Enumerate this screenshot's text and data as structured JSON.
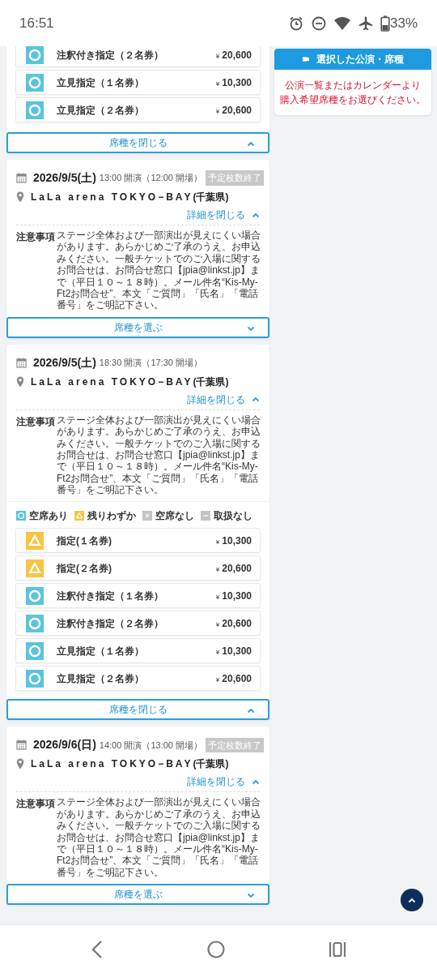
{
  "status_bar": {
    "time": "16:51",
    "battery": "33%"
  },
  "sidebar": {
    "title": "選択した公演・席種",
    "message_lines": [
      "公演一覧またはカレンダーより",
      "購入希望席種をお選びください。"
    ]
  },
  "performances": [
    {
      "kind": "partial",
      "seats_expanded": true,
      "seat_toggle": "席種を閉じる",
      "seats": [
        {
          "kind": "available",
          "name": "注釈付き指定（２名券）",
          "currency": "¥",
          "price": "20,600"
        },
        {
          "kind": "available",
          "name": "立見指定（１名券）",
          "currency": "¥",
          "price": "10,300"
        },
        {
          "kind": "available",
          "name": "立見指定（２名券）",
          "currency": "¥",
          "price": "20,600"
        }
      ]
    },
    {
      "kind": "full",
      "date": "2026/9/5(土)",
      "time": "13:00 開演（12:00 開場）",
      "badge": "予定枚数終了",
      "venue": "LaLa arena TOKYO−BAY",
      "prefecture": "(千葉県)",
      "details_toggle": "詳細を閉じる",
      "details_expanded": true,
      "notes_label": "注意事項",
      "notes": "ステージ全体および一部演出が見えにくい場合があります。あらかじめご了承のうえ、お申込みください。一般チケットでのご入場に関するお問合せは、お問合せ窓口【jpia@linkst.jp】まで（平日１０～１８時）。メール件名“Kis-My-Ft2お問合せ”、本文「ご質問」「氏名」「電話番号」をご明記下さい。",
      "seats_expanded": false,
      "seat_toggle": "席種を選ぶ"
    },
    {
      "kind": "full",
      "date": "2026/9/5(土)",
      "time": "18:30 開演（17:30 開場）",
      "venue": "LaLa arena TOKYO−BAY",
      "prefecture": "(千葉県)",
      "details_toggle": "詳細を閉じる",
      "details_expanded": true,
      "notes_label": "注意事項",
      "notes": "ステージ全体および一部演出が見えにくい場合があります。あらかじめご了承のうえ、お申込みください。一般チケットでのご入場に関するお問合せは、お問合せ窓口【jpia@linkst.jp】まで（平日１０～１８時）。メール件名“Kis-My-Ft2お問合せ”、本文「ご質問」「氏名」「電話番号」をご明記下さい。",
      "legend": [
        {
          "kind": "available",
          "label": "空席あり"
        },
        {
          "kind": "few",
          "label": "残りわずか"
        },
        {
          "kind": "none",
          "label": "空席なし"
        },
        {
          "kind": "na",
          "label": "取扱なし"
        }
      ],
      "seats_expanded": true,
      "seat_toggle": "席種を閉じる",
      "seats": [
        {
          "kind": "few",
          "name": "指定(１名券)",
          "currency": "¥",
          "price": "10,300"
        },
        {
          "kind": "few",
          "name": "指定(２名券)",
          "currency": "¥",
          "price": "20,600"
        },
        {
          "kind": "available",
          "name": "注釈付き指定（１名券）",
          "currency": "¥",
          "price": "10,300"
        },
        {
          "kind": "available",
          "name": "注釈付き指定（２名券）",
          "currency": "¥",
          "price": "20,600"
        },
        {
          "kind": "available",
          "name": "立見指定（１名券）",
          "currency": "¥",
          "price": "10,300"
        },
        {
          "kind": "available",
          "name": "立見指定（２名券）",
          "currency": "¥",
          "price": "20,600"
        }
      ]
    },
    {
      "kind": "full",
      "date": "2026/9/6(日)",
      "time": "14:00 開演（13:00 開場）",
      "badge": "予定枚数終了",
      "venue": "LaLa arena TOKYO−BAY",
      "prefecture": "(千葉県)",
      "details_toggle": "詳細を閉じる",
      "details_expanded": true,
      "notes_label": "注意事項",
      "notes": "ステージ全体および一部演出が見えにくい場合があります。あらかじめご了承のうえ、お申込みください。一般チケットでのご入場に関するお問合せは、お問合せ窓口【jpia@linkst.jp】まで（平日１０～１８時）。メール件名“Kis-My-Ft2お問合せ”、本文「ご質問」「氏名」「電話番号」をご明記下さい。",
      "seats_expanded": false,
      "seat_toggle": "席種を選ぶ"
    }
  ]
}
